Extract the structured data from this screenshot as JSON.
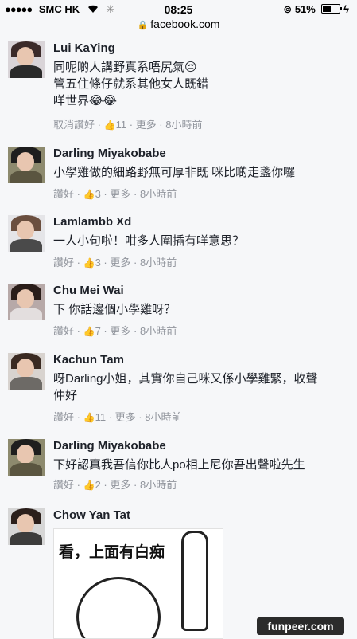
{
  "status_bar": {
    "carrier": "SMC HK",
    "time": "08:25",
    "battery_percent": "51%",
    "battery_level": 0.51,
    "icons": [
      "signal-dots-icon",
      "wifi-icon",
      "loading-icon",
      "rotation-lock-icon",
      "battery-icon",
      "charging-icon"
    ]
  },
  "url_bar": {
    "url": "facebook.com",
    "icon": "lock-icon"
  },
  "comments": [
    {
      "name": "Lui KaYing",
      "lines": [
        "同呢啲人講野真系唔尻氣😔",
        "管五住條仔就系其他女人既錯",
        "咩世界😂😂"
      ],
      "like_action": "取消讚好",
      "likes": "11",
      "more": "更多",
      "time": "8小時前"
    },
    {
      "name": "Darling Miyakobabe",
      "lines": [
        "小學雞做的細路野無可厚非既 咪比啲走盞你囉"
      ],
      "like_action": "讚好",
      "likes": "3",
      "more": "更多",
      "time": "8小時前"
    },
    {
      "name": "Lamlambb Xd",
      "lines": [
        "一人小句啦！咁多人圍插有咩意思？"
      ],
      "like_action": "讚好",
      "likes": "3",
      "more": "更多",
      "time": "8小時前"
    },
    {
      "name": "Chu Mei Wai",
      "lines": [
        "下 你話邊個小學雞呀？"
      ],
      "like_action": "讚好",
      "likes": "7",
      "more": "更多",
      "time": "8小時前"
    },
    {
      "name": "Kachun Tam",
      "lines": [
        "呀Darling小姐，其實你自己咪又係小學雞緊，收聲",
        "仲好"
      ],
      "like_action": "讚好",
      "likes": "11",
      "more": "更多",
      "time": "8小時前"
    },
    {
      "name": "Darling Miyakobabe",
      "lines": [
        "下好認真我吾信你比人po相上尼你吾出聲啦先生"
      ],
      "like_action": "讚好",
      "likes": "2",
      "more": "更多",
      "time": "8小時前"
    },
    {
      "name": "Chow Yan Tat",
      "meme_text": "看，上面有白痴"
    }
  ],
  "separator": "·",
  "watermark": "funpeer.com",
  "colors": {
    "link": "#4267b2",
    "meta": "#90949c",
    "text": "#1d2129",
    "background": "#f6f7f9"
  }
}
